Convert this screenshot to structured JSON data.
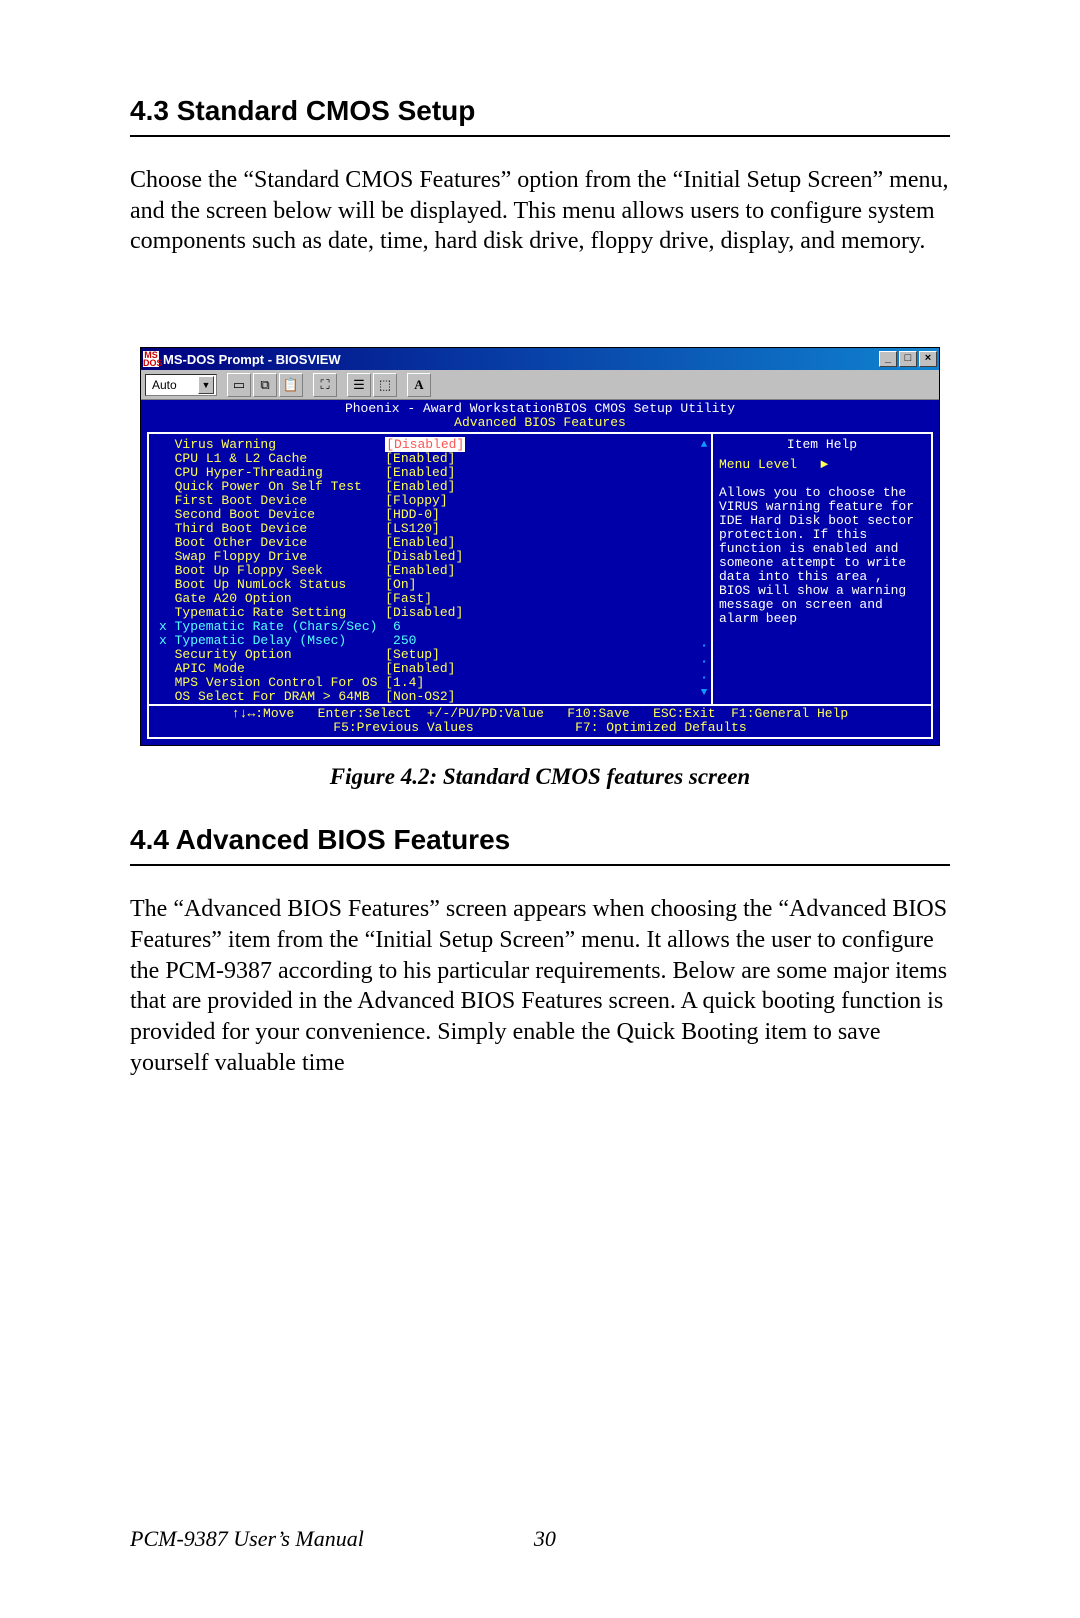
{
  "section1": {
    "heading": "4.3  Standard CMOS Setup",
    "body": "Choose the “Standard CMOS Features” option from the “Initial Setup Screen” menu, and the screen below will be displayed. This menu allows users to configure system components such as date, time, hard disk drive, floppy drive, display, and memory."
  },
  "figure": {
    "caption": "Figure 4.2: Standard CMOS features screen"
  },
  "section2": {
    "heading": "4.4  Advanced BIOS Features",
    "body": "The “Advanced BIOS Features” screen appears when choosing the “Advanced BIOS Features” item from the “Initial Setup Screen” menu. It allows the user to configure the PCM-9387 according to his particular requirements. Below are some major items that are provided in the Advanced BIOS Features screen. A quick booting function is provided for your convenience. Simply enable the Quick Booting item to save yourself valuable time"
  },
  "footer": {
    "manual": "PCM-9387 User’s Manual",
    "page": "30"
  },
  "bios": {
    "window_title": "MS-DOS Prompt - BIOSVIEW",
    "toolbar_dropdown": "Auto",
    "header1": "Phoenix - Award WorkstationBIOS CMOS Setup Utility",
    "header2": "Advanced BIOS Features",
    "items": [
      {
        "label": "Virus Warning",
        "value": "Disabled",
        "hl": true
      },
      {
        "label": "CPU L1 & L2 Cache",
        "value": "Enabled"
      },
      {
        "label": "CPU Hyper-Threading",
        "value": "Enabled"
      },
      {
        "label": "Quick Power On Self Test",
        "value": "Enabled"
      },
      {
        "label": "First Boot Device",
        "value": "Floppy"
      },
      {
        "label": "Second Boot Device",
        "value": "HDD-0"
      },
      {
        "label": "Third Boot Device",
        "value": "LS120"
      },
      {
        "label": "Boot Other Device",
        "value": "Enabled"
      },
      {
        "label": "Swap Floppy Drive",
        "value": "Disabled"
      },
      {
        "label": "Boot Up Floppy Seek",
        "value": "Enabled"
      },
      {
        "label": "Boot Up NumLock Status",
        "value": "On"
      },
      {
        "label": "Gate A20 Option",
        "value": "Fast"
      },
      {
        "label": "Typematic Rate Setting",
        "value": "Disabled"
      },
      {
        "label": "Typematic Rate (Chars/Sec)",
        "value": "6",
        "x": true,
        "nobr": true
      },
      {
        "label": "Typematic Delay (Msec)",
        "value": "250",
        "x": true,
        "nobr": true
      },
      {
        "label": "Security Option",
        "value": "Setup"
      },
      {
        "label": "APIC Mode",
        "value": "Enabled"
      },
      {
        "label": "MPS Version Control For OS",
        "value": "1.4"
      },
      {
        "label": "OS Select For DRAM > 64MB",
        "value": "Non-OS2"
      }
    ],
    "help_title": "Item Help",
    "help_level": "Menu Level   ►",
    "help_text": "Allows you to choose the VIRUS warning feature for IDE Hard Disk boot sector protection. If this function is enabled and someone attempt to write data into this area ,  BIOS will show a warning message on screen and alarm beep",
    "footer1": "↑↓↔:Move   Enter:Select  +/-/PU/PD:Value   F10:Save   ESC:Exit  F1:General Help",
    "footer2": "F5:Previous Values             F7: Optimized Defaults"
  }
}
